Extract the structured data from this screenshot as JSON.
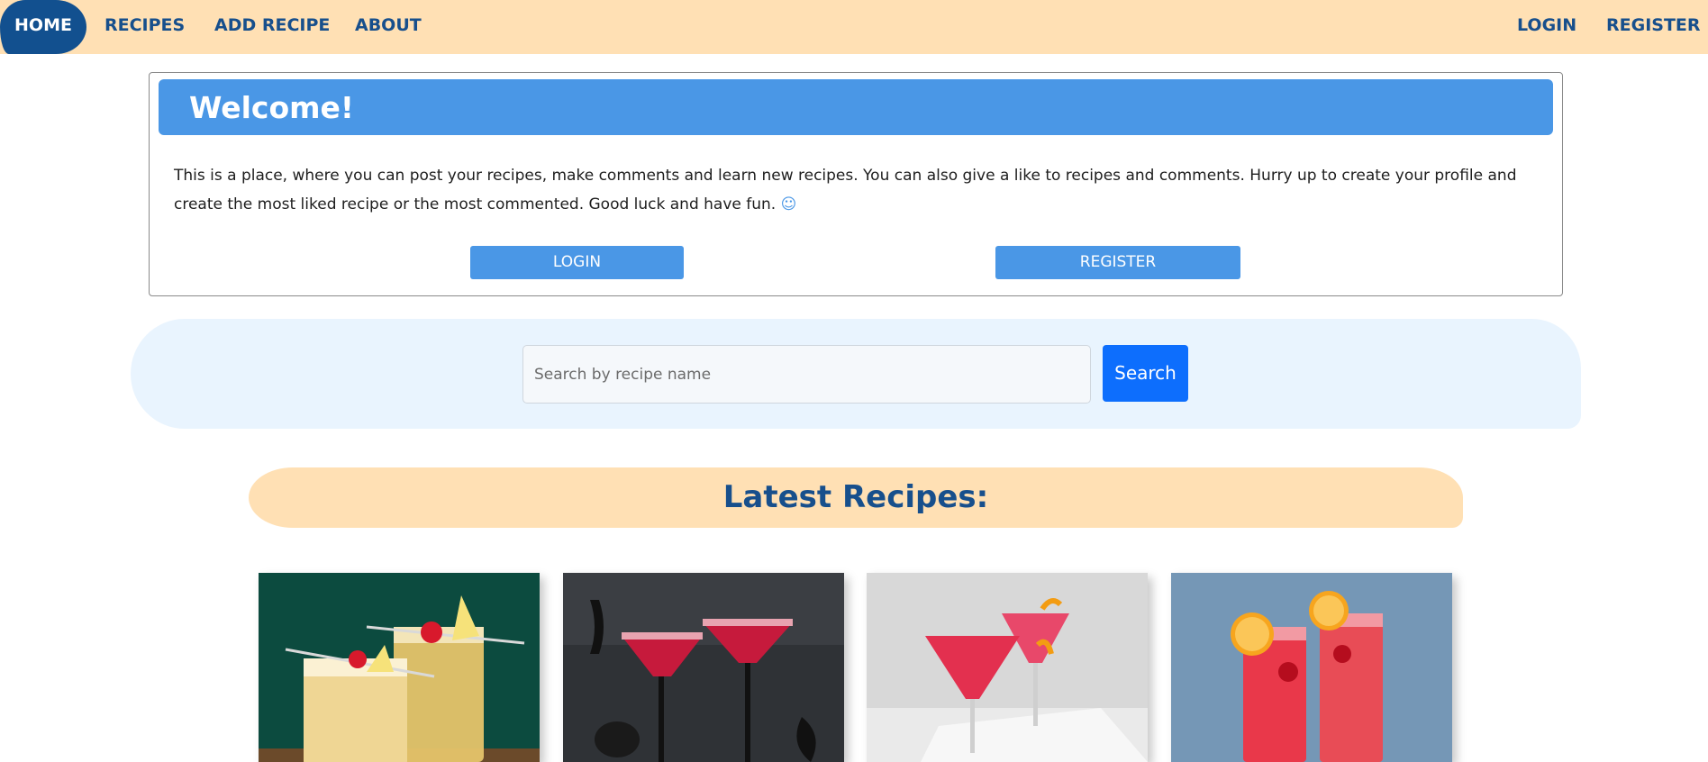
{
  "nav": {
    "home": "HOME",
    "recipes": "RECIPES",
    "add_recipe": "ADD RECIPE",
    "about": "ABOUT",
    "login": "LOGIN",
    "register": "REGISTER"
  },
  "welcome": {
    "title": "Welcome!",
    "text": "This is a place, where you can post your recipes, make comments and learn new recipes. You can also give a like to recipes and comments. Hurry up to create your profile and create the most liked recipe or the most commented. Good luck and have fun.",
    "smiley": "☺",
    "login_button": "LOGIN",
    "register_button": "REGISTER"
  },
  "search": {
    "placeholder": "Search by recipe name",
    "value": "",
    "button": "Search"
  },
  "latest": {
    "title": "Latest Recipes:"
  },
  "colors": {
    "nav_bg": "#ffe0b4",
    "nav_text": "#174f8c",
    "accent_blue": "#4a97e6",
    "primary_button": "#0d6efd",
    "search_band": "#e9f4fe"
  }
}
